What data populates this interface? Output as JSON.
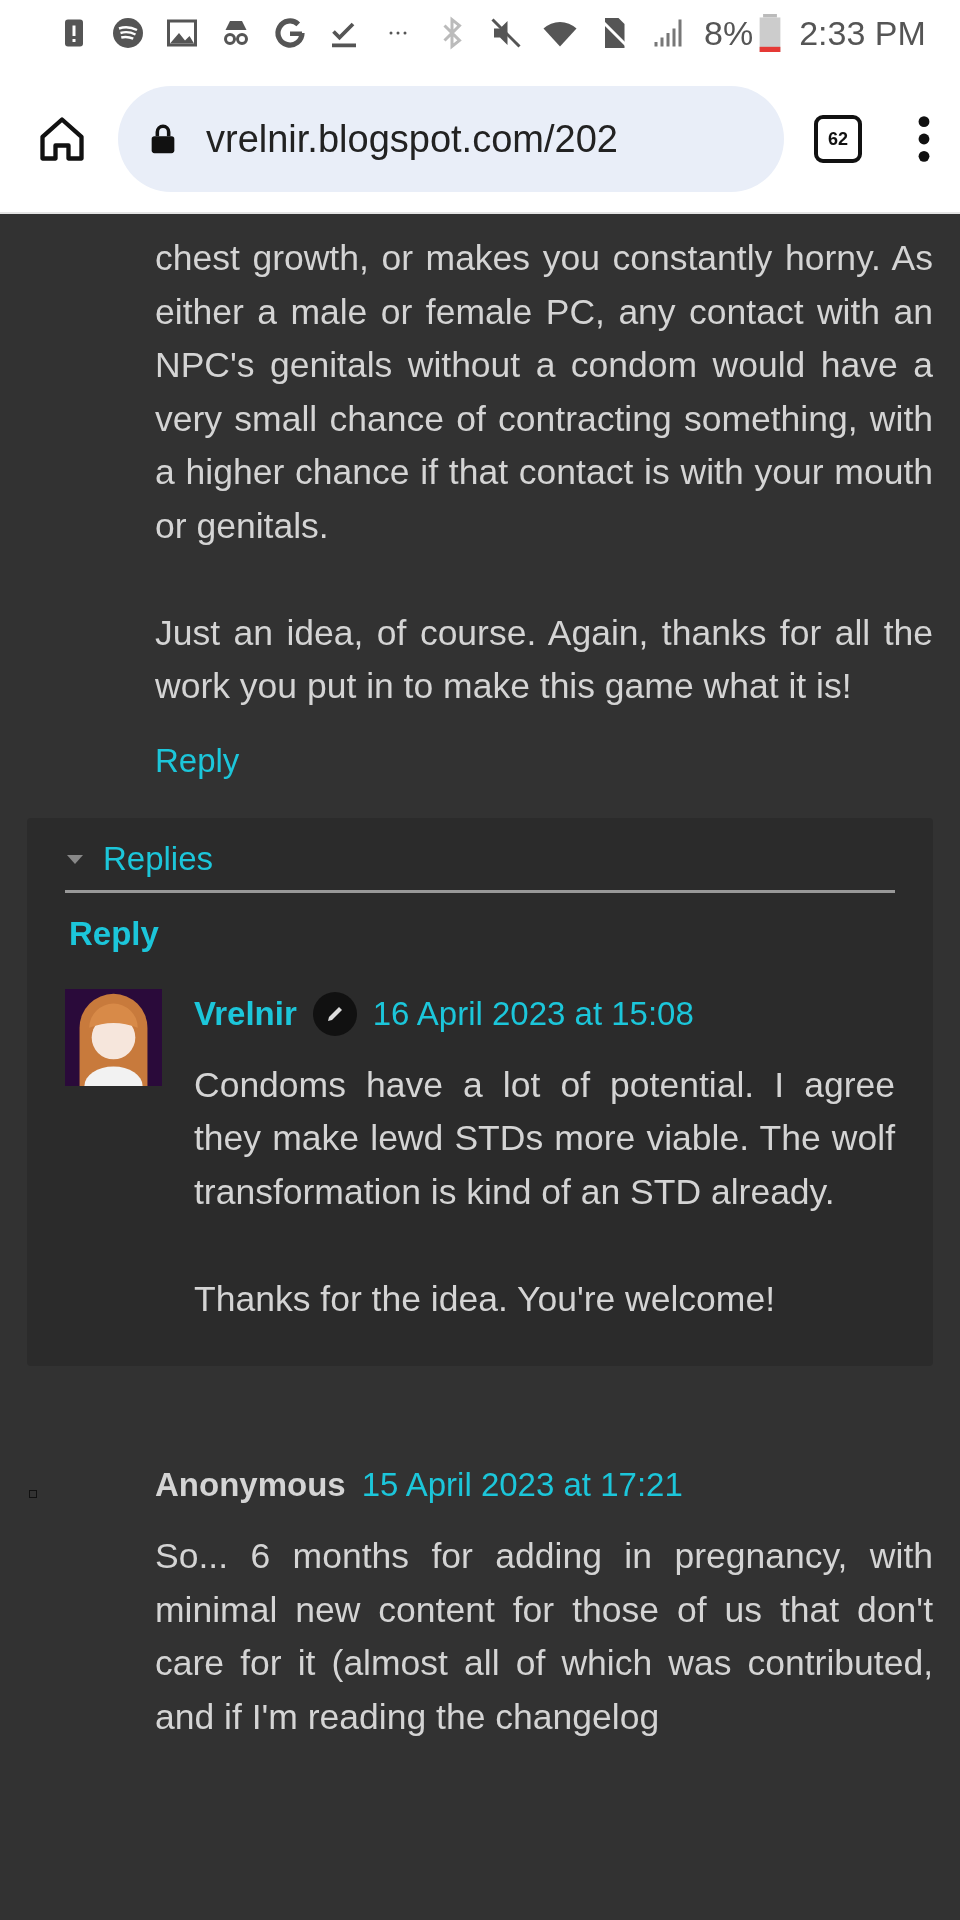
{
  "status_bar": {
    "battery": "8%",
    "time": "2:33 PM"
  },
  "browser": {
    "url": "vrelnir.blogspot.com/202",
    "tab_count": "62"
  },
  "comment": {
    "paragraphs": [
      "chest growth, or makes you constantly horny. As either a male or female PC, any contact with an NPC's genitals without a condom would have a very small chance of contracting something, with a higher chance if that contact is with your mouth or genitals.",
      "Just an idea, of course. Again, thanks for all the work you put in to make this game what it is!"
    ],
    "reply_link": "Reply"
  },
  "replies": {
    "toggle": "Replies",
    "expanded": true,
    "reply_link": "Reply",
    "items": [
      {
        "author": "Vrelnir",
        "is_author": true,
        "date": "16 April 2023 at 15:08",
        "paragraphs": [
          "Condoms have a lot of potential. I agree they make lewd STDs more viable. The wolf transformation is kind of an STD already.",
          "Thanks for the idea. You're welcome!"
        ]
      }
    ]
  },
  "next_comment": {
    "author": "Anonymous",
    "date": "15 April 2023 at 17:21",
    "paragraphs": [
      "So... 6 months for adding in pregnancy, with minimal new content for those of us that don't care for it (almost all of which was contributed, and if I'm reading the changelog"
    ]
  }
}
